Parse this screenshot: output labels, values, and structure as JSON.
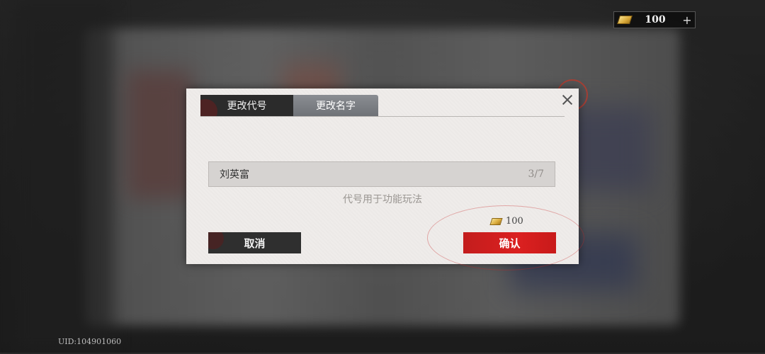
{
  "currency": {
    "icon": "gold-bar-icon",
    "value": "100",
    "add_label": "+"
  },
  "uid_label": "UID:104901060",
  "dialog": {
    "tabs": [
      {
        "label": "更改代号",
        "active": true
      },
      {
        "label": "更改名字",
        "active": false
      }
    ],
    "name_input": {
      "value": "刘英富",
      "counter": "3/7"
    },
    "hint": "代号用于功能玩法",
    "cost": {
      "icon": "gold-bar-icon",
      "value": "100"
    },
    "cancel_label": "取消",
    "confirm_label": "确认",
    "close_icon": "close-icon"
  },
  "colors": {
    "confirm": "#d81e1e",
    "dark": "#2b2b2b",
    "paper": "#efecea"
  }
}
